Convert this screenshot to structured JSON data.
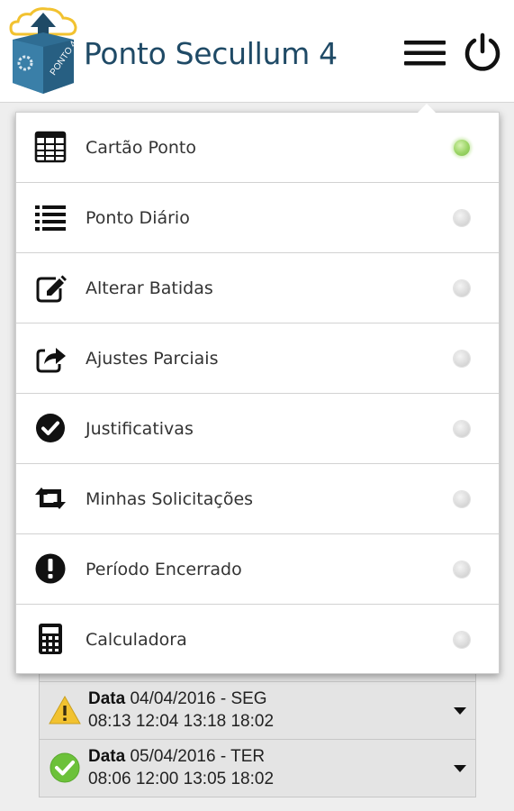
{
  "header": {
    "title": "Ponto Secullum 4",
    "logo_text": "PONTO 4"
  },
  "colors": {
    "title": "#1f4a66",
    "active_dot": "#8ccb56",
    "inactive_dot": "#d6d6d6",
    "warning": "#f2c230",
    "success": "#6cc13a"
  },
  "menu": {
    "items": [
      {
        "label": "Cartão Ponto",
        "icon": "timesheet-grid-icon",
        "active": true
      },
      {
        "label": "Ponto Diário",
        "icon": "list-icon",
        "active": false
      },
      {
        "label": "Alterar Batidas",
        "icon": "edit-icon",
        "active": false
      },
      {
        "label": "Ajustes Parciais",
        "icon": "share-icon",
        "active": false
      },
      {
        "label": "Justificativas",
        "icon": "check-circle-icon",
        "active": false
      },
      {
        "label": "Minhas Solicitações",
        "icon": "retweet-icon",
        "active": false
      },
      {
        "label": "Período Encerrado",
        "icon": "exclamation-circle-icon",
        "active": false
      },
      {
        "label": "Calculadora",
        "icon": "calculator-icon",
        "active": false
      }
    ]
  },
  "records": [
    {
      "label": "Data",
      "date": "04/04/2016 - SEG",
      "times": "08:13 12:04 13:18 18:02",
      "status": "warning"
    },
    {
      "label": "Data",
      "date": "05/04/2016 - TER",
      "times": "08:06 12:00 13:05 18:02",
      "status": "ok"
    }
  ]
}
